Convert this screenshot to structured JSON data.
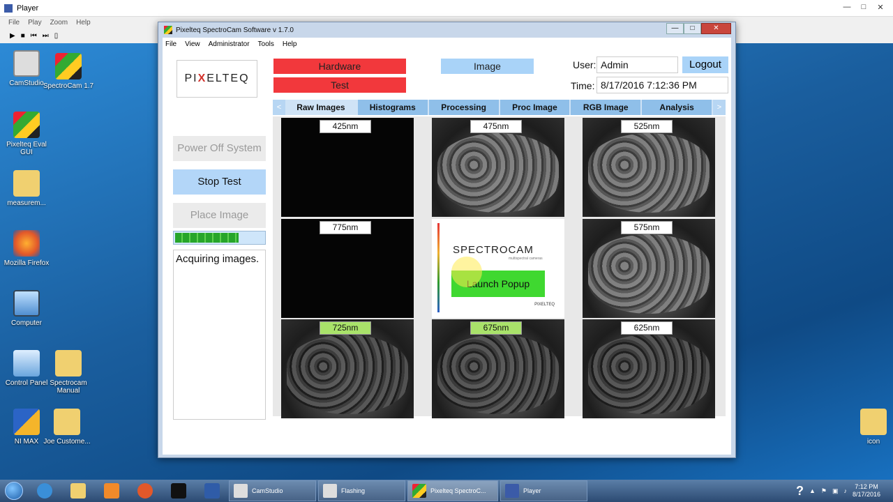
{
  "player": {
    "title": "Player",
    "menu": [
      "File",
      "Play",
      "Zoom",
      "Help"
    ]
  },
  "desktop_icons": [
    {
      "label": "CamStudio"
    },
    {
      "label": "SpectroCam 1.7"
    },
    {
      "label": "Pixelteq Eval GUI"
    },
    {
      "label": "measurem..."
    },
    {
      "label": "Mozilla Firefox"
    },
    {
      "label": "Computer"
    },
    {
      "label": "Control Panel"
    },
    {
      "label": "Spectrocam Manual"
    },
    {
      "label": "NI MAX"
    },
    {
      "label": "Joe Custome..."
    },
    {
      "label": "icon"
    }
  ],
  "app": {
    "title": "Pixelteq SpectroCam Software v 1.7.0",
    "menu": [
      "File",
      "View",
      "Administrator",
      "Tools",
      "Help"
    ],
    "logo_left": "PI",
    "logo_x": "X",
    "logo_right": "ELTEQ",
    "buttons": {
      "power_off": "Power Off System",
      "stop_test": "Stop Test",
      "place_image": "Place Image"
    },
    "progress_fraction": 0.72,
    "status_text": "Acquiring images.",
    "hardware": "Hardware",
    "test": "Test",
    "image": "Image",
    "user_label": "User:",
    "user_value": "Admin",
    "logout": "Logout",
    "time_label": "Time:",
    "time_value": "8/17/2016 7:12:36 PM",
    "tabs": [
      "Raw Images",
      "Histograms",
      "Processing",
      "Proc Image",
      "RGB Image",
      "Analysis"
    ],
    "tab_left_arrow": "<",
    "tab_right_arrow": ">",
    "cells": [
      {
        "label": "425nm"
      },
      {
        "label": "475nm"
      },
      {
        "label": "525nm"
      },
      {
        "label": "775nm"
      },
      {
        "label": "575nm"
      },
      {
        "label": "725nm"
      },
      {
        "label": "675nm"
      },
      {
        "label": "625nm"
      }
    ],
    "splash": {
      "brand": "SPECTROCAM",
      "sub": "multispectral cameras",
      "launch": "Launch Popup",
      "small": "PIXELTEQ"
    }
  },
  "taskbar": {
    "tasks": [
      "CamStudio",
      "Flashing",
      "Pixelteq SpectroC...",
      "Player"
    ],
    "time": "7:12 PM",
    "date": "8/17/2016"
  }
}
